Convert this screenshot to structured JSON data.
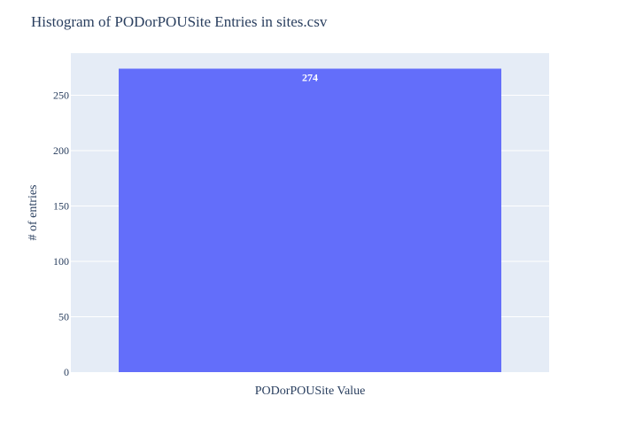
{
  "chart_data": {
    "type": "bar",
    "title": "Histogram of PODorPOUSite Entries in sites.csv",
    "xlabel": "PODorPOUSite Value",
    "ylabel": "# of entries",
    "categories": [
      ""
    ],
    "values": [
      274
    ],
    "data_labels": [
      "274"
    ],
    "ylim": [
      0,
      288
    ],
    "yticks": [
      0,
      50,
      100,
      150,
      200,
      250
    ],
    "grid": true,
    "legend": "none",
    "colors": {
      "bar": "#636efa",
      "plot_background": "#e5ecf6",
      "gridline": "#ffffff",
      "text": "#2a3f5f",
      "data_label": "#ffffff"
    }
  }
}
